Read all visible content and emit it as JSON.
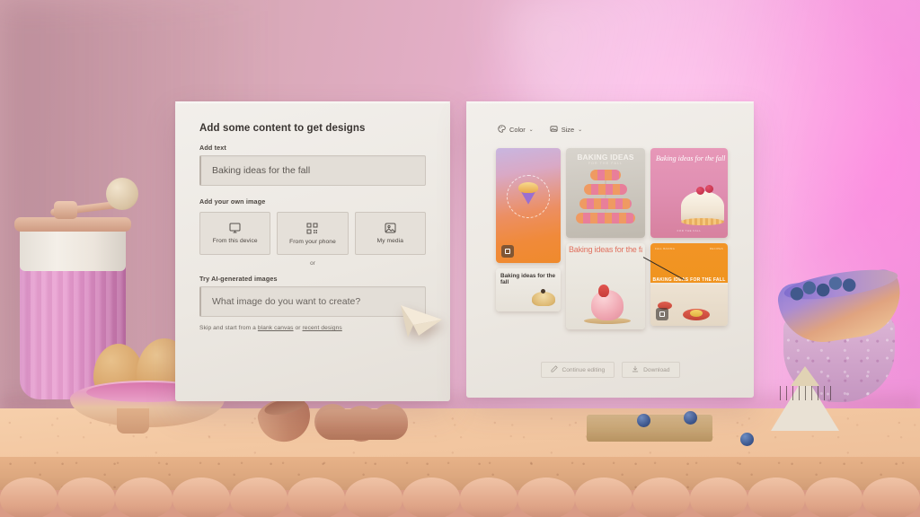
{
  "scene": {
    "background_colors": {
      "wall_left": "#cfa2ac",
      "wall_right": "#ec93d8",
      "counter_top": "#f3c8a2",
      "counter_front": "#dda87f",
      "scallop": "#dfa487"
    },
    "props": [
      {
        "name": "pink-coffee-grinder",
        "color": "#e79fd0"
      },
      {
        "name": "egg-bowl-with-eggs",
        "color": "#e6a2c4"
      },
      {
        "name": "copper-cookie-cutters",
        "color": "#c4876a"
      },
      {
        "name": "wavy-wooden-board",
        "color": "#cbaa79"
      },
      {
        "name": "blueberries",
        "color": "#3f5b92"
      },
      {
        "name": "gradient-bowl-with-blueberries",
        "color": "#a98bd4"
      },
      {
        "name": "speckled-purple-bowl",
        "color": "#d3a8cd"
      },
      {
        "name": "cream-cone-object",
        "color": "#e9e1d4"
      }
    ]
  },
  "left_panel": {
    "title": "Add some content to get designs",
    "add_text": {
      "label": "Add text",
      "value": "Baking ideas for the fall"
    },
    "add_image": {
      "label": "Add your own image",
      "buttons": [
        {
          "label": "From this device",
          "icon": "monitor-icon"
        },
        {
          "label": "From your phone",
          "icon": "qr-code-icon"
        },
        {
          "label": "My media",
          "icon": "photo-icon"
        }
      ]
    },
    "divider": "or",
    "ai_images": {
      "label": "Try AI-generated images",
      "placeholder": "What image do you want to create?",
      "value": ""
    },
    "footnote": {
      "prefix": "Skip and start from a ",
      "link1": "blank canvas",
      "middle": " or ",
      "link2": "recent designs"
    }
  },
  "right_panel": {
    "toolbar": [
      {
        "label": "Color",
        "icon": "palette-icon",
        "chevron": "⌄"
      },
      {
        "label": "Size",
        "icon": "frame-icon",
        "chevron": "⌄"
      }
    ],
    "designs": [
      {
        "id": "design-cupcake-gradient",
        "text": "",
        "badge": "image-badge",
        "accent": "#f08a3a"
      },
      {
        "id": "design-baking-ideas-small",
        "text": "Baking ideas for the fall",
        "accent": "#ddb871"
      },
      {
        "id": "design-baking-ideas-macarons",
        "headline": "BAKING IDEAS",
        "subhead": "FOR THE FALL",
        "accent": "#e87f9a"
      },
      {
        "id": "design-repeated-text-cake",
        "text": "Baking ideas for the fall Baking ideas for the fall Baking ideas for the fall",
        "accent": "#e0715f"
      },
      {
        "id": "design-pink-dome-cherries",
        "text": "Baking ideas for the fall",
        "caption": "FOR THE FALL",
        "accent": "#e08fb2"
      },
      {
        "id": "design-orange-banner",
        "band": "BAKING IDEAS FOR THE FALL",
        "corner_left": "FALL BAKING",
        "corner_right": "RECIPES",
        "badge": "image-badge",
        "accent": "#f0941f"
      }
    ],
    "actions": [
      {
        "label": "Continue editing",
        "icon": "pencil-icon",
        "disabled": true
      },
      {
        "label": "Download",
        "icon": "download-icon",
        "disabled": true
      }
    ]
  }
}
